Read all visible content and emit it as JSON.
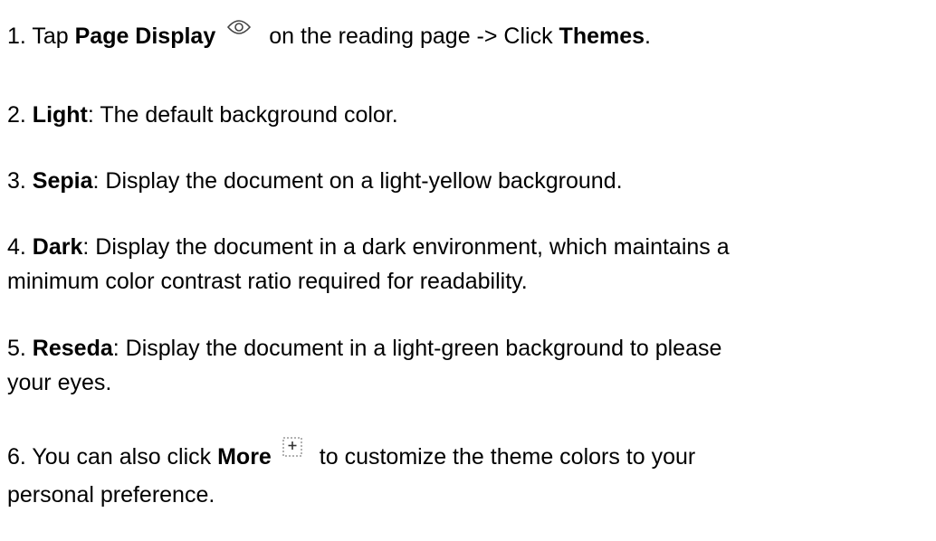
{
  "steps": [
    {
      "num": "1. ",
      "pre": "Tap ",
      "bold1": "Page Display",
      "icon": "eye-icon",
      "mid": " on the reading page -> Click ",
      "bold2": "Themes",
      "post": "."
    },
    {
      "num": "2. ",
      "term": "Light",
      "desc": ": The default background color."
    },
    {
      "num": "3. ",
      "term": "Sepia",
      "desc": ": Display the document on a light-yellow background."
    },
    {
      "num": "4. ",
      "term": "Dark",
      "desc": ": Display the document in a dark environment, which maintains a",
      "desc2": "minimum color contrast ratio required for readability."
    },
    {
      "num": "5. ",
      "term": "Reseda",
      "desc": ": Display the document in a light-green background to please",
      "desc2": "your eyes."
    },
    {
      "num": "6. ",
      "pre": "You can also click ",
      "bold1": "More",
      "icon": "plus-box-icon",
      "post": " to customize the theme colors to your",
      "post2": "personal preference."
    }
  ],
  "colors": {
    "text": "#000000",
    "icon": "#444444",
    "background": "#ffffff"
  }
}
